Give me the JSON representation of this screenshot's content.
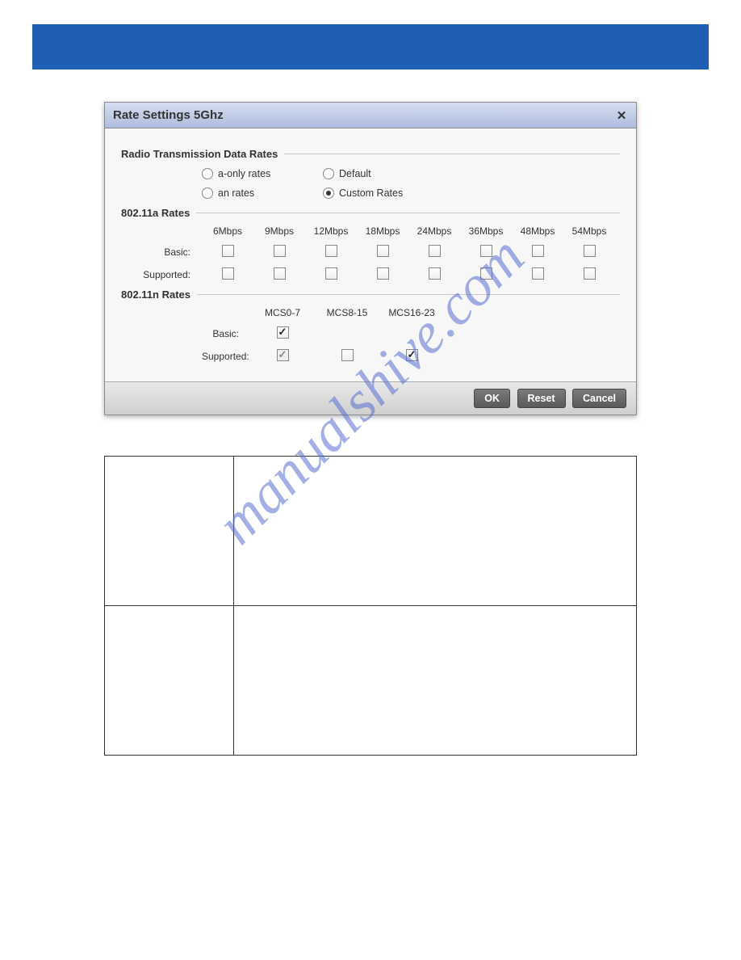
{
  "dialog": {
    "title": "Rate Settings 5Ghz",
    "section1": "Radio Transmission Data Rates",
    "radios": {
      "a_only": "a-only rates",
      "default": "Default",
      "an": "an rates",
      "custom": "Custom Rates",
      "selected": "custom"
    },
    "section_a": "802.11a Rates",
    "a_cols": [
      "6Mbps",
      "9Mbps",
      "12Mbps",
      "18Mbps",
      "24Mbps",
      "36Mbps",
      "48Mbps",
      "54Mbps"
    ],
    "row_basic": "Basic:",
    "row_supported": "Supported:",
    "a_basic": [
      false,
      false,
      false,
      false,
      false,
      false,
      false,
      false
    ],
    "a_supported": [
      false,
      false,
      false,
      false,
      false,
      false,
      false,
      false
    ],
    "section_n": "802.11n Rates",
    "n_cols": [
      "MCS0-7",
      "MCS8-15",
      "MCS16-23"
    ],
    "n_basic": [
      true
    ],
    "n_supported": [
      true,
      false,
      true
    ],
    "n_supported_disabled": [
      true,
      false,
      false
    ],
    "buttons": {
      "ok": "OK",
      "reset": "Reset",
      "cancel": "Cancel"
    }
  },
  "watermark": "manualshive.com"
}
